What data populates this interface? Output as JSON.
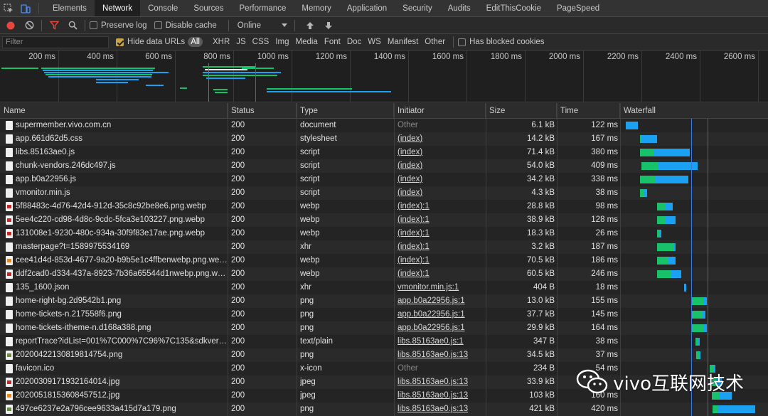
{
  "tabs": [
    {
      "label": "Elements",
      "active": false
    },
    {
      "label": "Network",
      "active": true
    },
    {
      "label": "Console",
      "active": false
    },
    {
      "label": "Sources",
      "active": false
    },
    {
      "label": "Performance",
      "active": false
    },
    {
      "label": "Memory",
      "active": false
    },
    {
      "label": "Application",
      "active": false
    },
    {
      "label": "Security",
      "active": false
    },
    {
      "label": "Audits",
      "active": false
    },
    {
      "label": "EditThisCookie",
      "active": false
    },
    {
      "label": "PageSpeed",
      "active": false
    }
  ],
  "toolbar": {
    "record_icon": "record-icon",
    "clear_icon": "clear-icon",
    "filter_icon": "filter-icon",
    "search_icon": "search-icon",
    "preserve_log": "Preserve log",
    "disable_cache": "Disable cache",
    "throttle": "Online",
    "upload_icon": "import-har-icon",
    "download_icon": "export-har-icon"
  },
  "filterbar": {
    "placeholder": "Filter",
    "hide_data_urls": "Hide data URLs",
    "types": [
      "All",
      "XHR",
      "JS",
      "CSS",
      "Img",
      "Media",
      "Font",
      "Doc",
      "WS",
      "Manifest",
      "Other"
    ],
    "active_type": "All",
    "blocked_cookies": "Has blocked cookies"
  },
  "overview": {
    "ticks": [
      "200 ms",
      "400 ms",
      "600 ms",
      "800 ms",
      "1000 ms",
      "1200 ms",
      "1400 ms",
      "1600 ms",
      "1800 ms",
      "2000 ms",
      "2200 ms",
      "2400 ms",
      "2600 ms"
    ]
  },
  "columns": [
    "Name",
    "Status",
    "Type",
    "Initiator",
    "Size",
    "Time",
    "Waterfall"
  ],
  "requests": [
    {
      "name": "supermember.vivo.com.cn",
      "status": "200",
      "type": "document",
      "initiator": "Other",
      "size": "6.1 kB",
      "time": "122 ms",
      "icon": "doc"
    },
    {
      "name": "app.661d62d5.css",
      "status": "200",
      "type": "stylesheet",
      "initiator": "(index)",
      "size": "14.2 kB",
      "time": "167 ms",
      "icon": "doc"
    },
    {
      "name": "libs.85163ae0.js",
      "status": "200",
      "type": "script",
      "initiator": "(index)",
      "size": "71.4 kB",
      "time": "380 ms",
      "icon": "doc"
    },
    {
      "name": "chunk-vendors.246dc497.js",
      "status": "200",
      "type": "script",
      "initiator": "(index)",
      "size": "54.0 kB",
      "time": "409 ms",
      "icon": "doc"
    },
    {
      "name": "app.b0a22956.js",
      "status": "200",
      "type": "script",
      "initiator": "(index)",
      "size": "34.2 kB",
      "time": "338 ms",
      "icon": "doc"
    },
    {
      "name": "vmonitor.min.js",
      "status": "200",
      "type": "script",
      "initiator": "(index)",
      "size": "4.3 kB",
      "time": "38 ms",
      "icon": "doc"
    },
    {
      "name": "5f88483c-4d76-42d4-912d-35c8c92be8e6.png.webp",
      "status": "200",
      "type": "webp",
      "initiator": "(index):1",
      "size": "28.8 kB",
      "time": "98 ms",
      "icon": "img"
    },
    {
      "name": "5ee4c220-cd98-4d8c-9cdc-5fca3e103227.png.webp",
      "status": "200",
      "type": "webp",
      "initiator": "(index):1",
      "size": "38.9 kB",
      "time": "128 ms",
      "icon": "img"
    },
    {
      "name": "131008e1-9230-480c-934a-30f9f83e17ae.png.webp",
      "status": "200",
      "type": "webp",
      "initiator": "(index):1",
      "size": "18.3 kB",
      "time": "26 ms",
      "icon": "img"
    },
    {
      "name": "masterpage?t=1589975534169",
      "status": "200",
      "type": "xhr",
      "initiator": "(index):1",
      "size": "3.2 kB",
      "time": "187 ms",
      "icon": "doc"
    },
    {
      "name": "cee41d4d-853d-4677-9a20-b9b5e1c4ffbenwebp.png.webp",
      "status": "200",
      "type": "webp",
      "initiator": "(index):1",
      "size": "70.5 kB",
      "time": "186 ms",
      "icon": "jpg"
    },
    {
      "name": "ddf2cad0-d334-437a-8923-7b36a65544d1nwebp.png.webp",
      "status": "200",
      "type": "webp",
      "initiator": "(index):1",
      "size": "60.5 kB",
      "time": "246 ms",
      "icon": "img"
    },
    {
      "name": "135_1600.json",
      "status": "200",
      "type": "xhr",
      "initiator": "vmonitor.min.js:1",
      "size": "404 B",
      "time": "18 ms",
      "icon": "doc"
    },
    {
      "name": "home-right-bg.2d9542b1.png",
      "status": "200",
      "type": "png",
      "initiator": "app.b0a22956.js:1",
      "size": "13.0 kB",
      "time": "155 ms",
      "icon": "doc"
    },
    {
      "name": "home-tickets-n.217558f6.png",
      "status": "200",
      "type": "png",
      "initiator": "app.b0a22956.js:1",
      "size": "37.7 kB",
      "time": "145 ms",
      "icon": "doc"
    },
    {
      "name": "home-tickets-itheme-n.d168a388.png",
      "status": "200",
      "type": "png",
      "initiator": "app.b0a22956.js:1",
      "size": "29.9 kB",
      "time": "164 ms",
      "icon": "doc"
    },
    {
      "name": "reportTrace?idList=001%7C000%7C96%7C135&sdkversi...",
      "status": "200",
      "type": "text/plain",
      "initiator": "libs.85163ae0.js:1",
      "size": "347 B",
      "time": "38 ms",
      "icon": "doc"
    },
    {
      "name": "20200422130819814754.png",
      "status": "200",
      "type": "png",
      "initiator": "libs.85163ae0.js:13",
      "size": "34.5 kB",
      "time": "37 ms",
      "icon": "png2"
    },
    {
      "name": "favicon.ico",
      "status": "200",
      "type": "x-icon",
      "initiator": "Other",
      "size": "234 B",
      "time": "54 ms",
      "icon": "doc"
    },
    {
      "name": "20200309171932164014.jpg",
      "status": "200",
      "type": "jpeg",
      "initiator": "libs.85163ae0.js:13",
      "size": "33.9 kB",
      "time": "",
      "icon": "img"
    },
    {
      "name": "20200518153608457512.jpg",
      "status": "200",
      "type": "jpeg",
      "initiator": "libs.85163ae0.js:13",
      "size": "103 kB",
      "time": "160 ms",
      "icon": "jpg"
    },
    {
      "name": "497ce6237e2a796cee9633a415d7a179.png",
      "status": "200",
      "type": "png",
      "initiator": "libs.85163ae0.js:13",
      "size": "421 kB",
      "time": "420 ms",
      "icon": "png2"
    }
  ],
  "watermark": {
    "text": "vivo互联网技术",
    "icon": "wechat-icon"
  },
  "colors": {
    "waiting": "#17c26b",
    "download": "#1ba1f2",
    "dom_line": "#3b78e7",
    "load_line": "#d93025"
  }
}
